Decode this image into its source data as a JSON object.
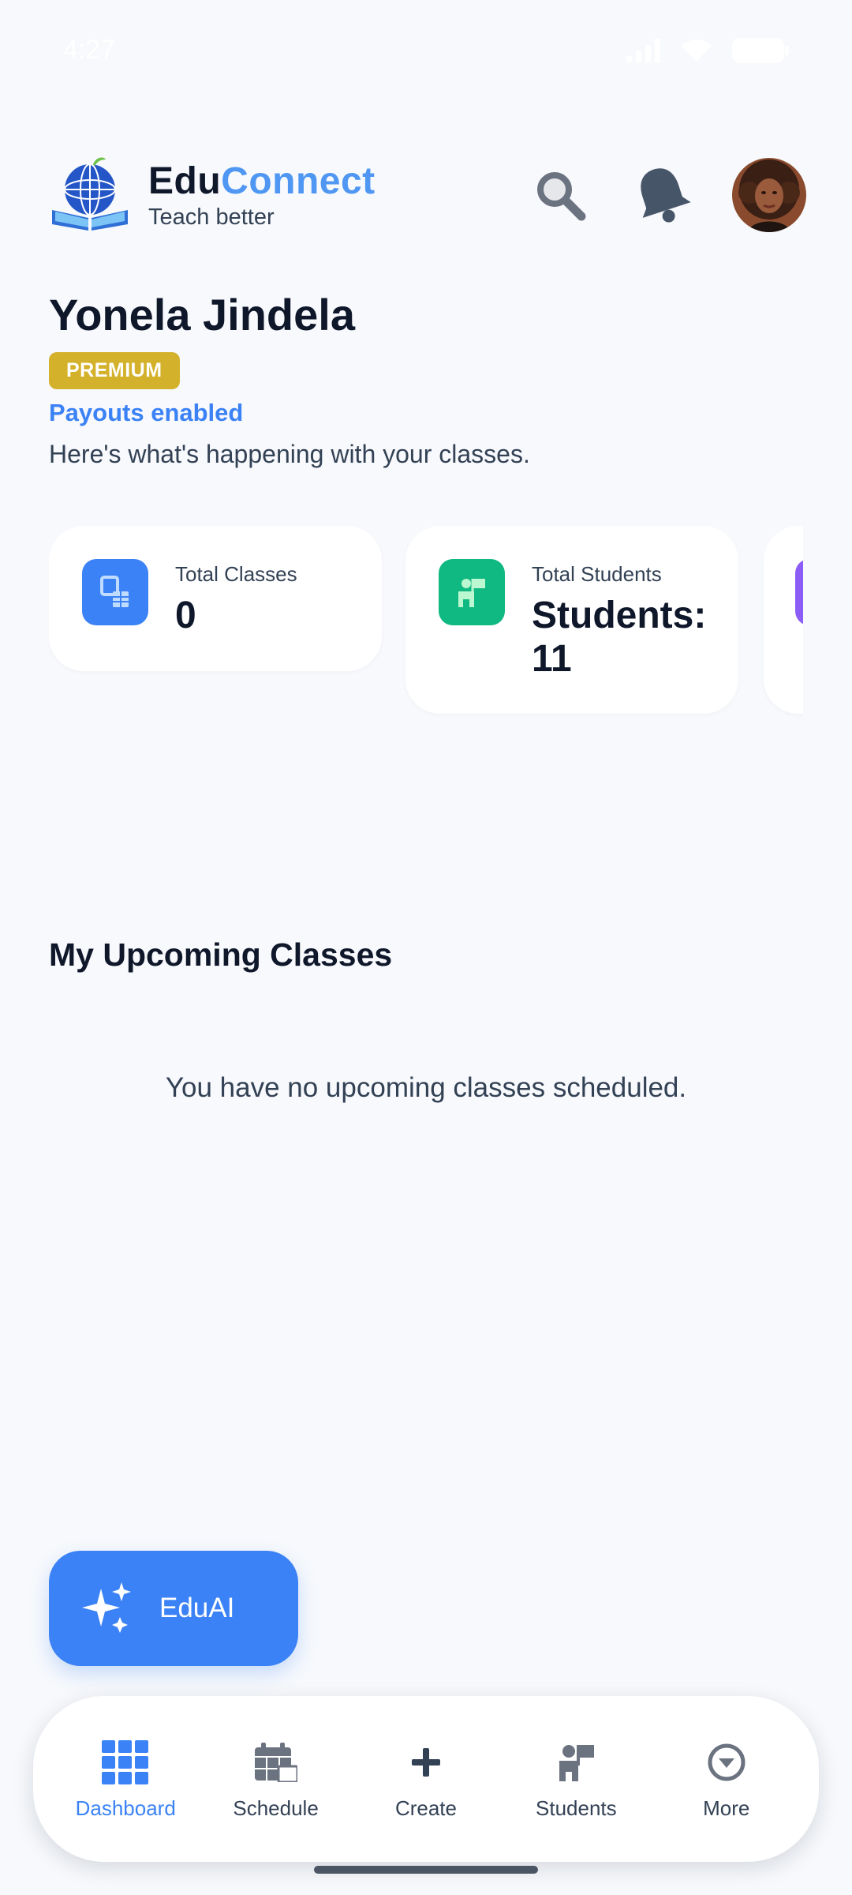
{
  "status_bar": {
    "time": "4:27"
  },
  "header": {
    "brand_edu": "Edu",
    "brand_connect": "Connect",
    "tagline": "Teach better",
    "icons": [
      "globe-book-logo",
      "search-icon",
      "bell-icon",
      "avatar"
    ]
  },
  "profile": {
    "name": "Yonela Jindela",
    "badge": "PREMIUM",
    "payouts": "Payouts enabled",
    "subtitle": "Here's what's happening with your classes."
  },
  "stats": [
    {
      "label": "Total Classes",
      "value": "0",
      "icon": "classes-icon",
      "color": "#3b82f6"
    },
    {
      "label": "Total Students",
      "value": "Students: 11",
      "icon": "students-icon",
      "color": "#10b981"
    },
    {
      "label": "",
      "value": "",
      "icon": "stat-icon",
      "color": "#8b5cf6"
    }
  ],
  "upcoming": {
    "title": "My Upcoming Classes",
    "empty": "You have no upcoming classes scheduled."
  },
  "fab": {
    "label": "EduAI",
    "icon": "sparkles-icon"
  },
  "nav": {
    "items": [
      {
        "label": "Dashboard",
        "icon": "grid-icon",
        "active": true
      },
      {
        "label": "Schedule",
        "icon": "calendar-icon",
        "active": false
      },
      {
        "label": "Create",
        "icon": "plus-icon",
        "active": false
      },
      {
        "label": "Students",
        "icon": "students-icon",
        "active": false
      },
      {
        "label": "More",
        "icon": "chevron-circle-icon",
        "active": false
      }
    ]
  },
  "colors": {
    "accent": "#3b82f6",
    "brand_connect": "#4f97f2",
    "premium": "#d4b12a",
    "students": "#10b981",
    "purple": "#8b5cf6",
    "background": "#f7f9fc"
  }
}
